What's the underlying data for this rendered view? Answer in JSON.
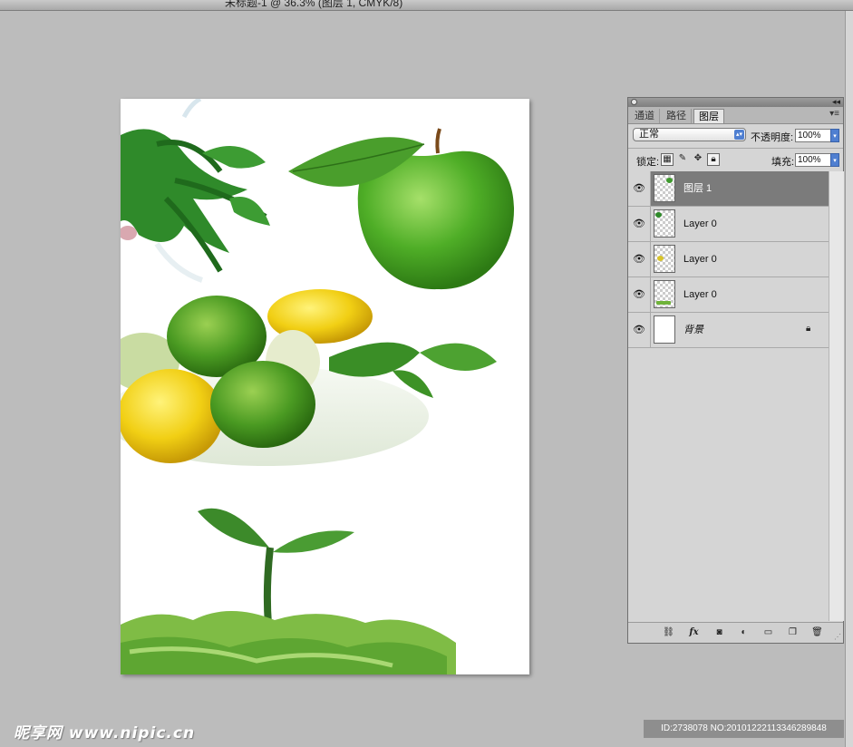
{
  "window": {
    "title": "未标题-1 @ 36.3% (图层 1, CMYK/8)"
  },
  "panel": {
    "tabs": [
      {
        "label": "通道",
        "active": false
      },
      {
        "label": "路径",
        "active": false
      },
      {
        "label": "图层",
        "active": true
      }
    ],
    "blend_mode": "正常",
    "opacity_label": "不透明度:",
    "opacity_value": "100%",
    "lock_label": "锁定:",
    "fill_label": "填充:",
    "fill_value": "100%",
    "layers": [
      {
        "name": "图层 1",
        "selected": true,
        "visible": true,
        "locked": false
      },
      {
        "name": "Layer 0",
        "selected": false,
        "visible": true,
        "locked": false
      },
      {
        "name": "Layer 0",
        "selected": false,
        "visible": true,
        "locked": false
      },
      {
        "name": "Layer 0",
        "selected": false,
        "visible": true,
        "locked": false
      },
      {
        "name": "背景",
        "selected": false,
        "visible": true,
        "locked": true
      }
    ],
    "footer_icons": [
      "link-icon",
      "fx-icon",
      "mask-icon",
      "adjustment-icon",
      "folder-icon",
      "new-layer-icon",
      "trash-icon"
    ]
  },
  "watermarks": {
    "left": "昵享网 www.nipic.cn",
    "right": "ID:2738078 NO:20101222113346289848"
  },
  "colors": {
    "workspace": "#bcbcbc",
    "panel_bg": "#d5d5d5",
    "selected_layer": "#7b7b7b",
    "apple_green": "#5cb832",
    "lemon_yellow": "#f3d21c"
  }
}
